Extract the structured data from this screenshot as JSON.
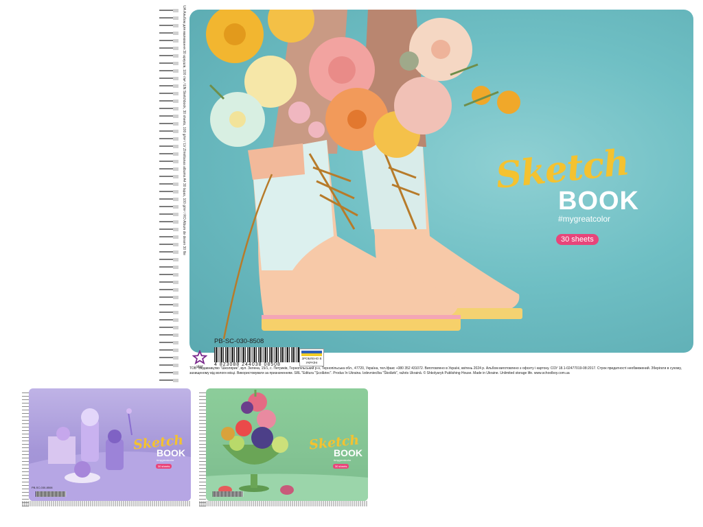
{
  "main": {
    "title_script": "Sketch",
    "title_bold": "BOOK",
    "tagline": "#mygreatcolor",
    "sheets": "30 sheets",
    "product_code": "PB-SC-030-8508",
    "barcode_number": "4 823088 244038 08508",
    "brand": "star",
    "ua_badge": "ЗРОБЛЕНО В УКРАЇНІ",
    "side_text": "UA Альбом для малювання 30 аркушів, 100 г/м² / EN Sketchbook, 30 sheets, 100 g/m² / LV Zīmēšanas albums A4 30 lapas, 100 g/m² / RO Album de desen 30 file",
    "legal_text": "ТОВ \"Видавництво \"Школярик\", вул. Зелена, 15/1, с. Петриків, Тернопільський р-н, Тернопільська обл., 47720, Україна, тел./факс +380 352 431072. Виготовлено в Україні, квітень 2024 р. Альбом виготовлено з офсету і картону. СОУ 18.1-02477019-08:2017. Строк придатності необмежений. Зберігати в сухому, захищеному від вологи місці. Використовувати за призначенням. SRL \"Editura \"Școlăriec\". Produs în Ukraina. Izdevniecība \"Školārik\", ražots Ukrainā. © Shkolyaryk Publishing House. Made in Ukraine. Unlimited storage life. www.schoolboy.com.ua",
    "colors": {
      "background": "#6fbfc4",
      "script": "#f4c230",
      "badge": "#e8457a"
    }
  },
  "thumb_purple": {
    "title_script": "Sketch",
    "title_bold": "BOOK",
    "tagline": "#mygreatcolor",
    "sheets": "30 sheets",
    "product_code": "PB-SC-030-8508",
    "colors": {
      "background": "#a89bd6"
    }
  },
  "thumb_green": {
    "title_script": "Sketch",
    "title_bold": "BOOK",
    "tagline": "#mygreatcolor",
    "sheets": "30 sheets",
    "colors": {
      "background": "#8cc79a"
    }
  }
}
